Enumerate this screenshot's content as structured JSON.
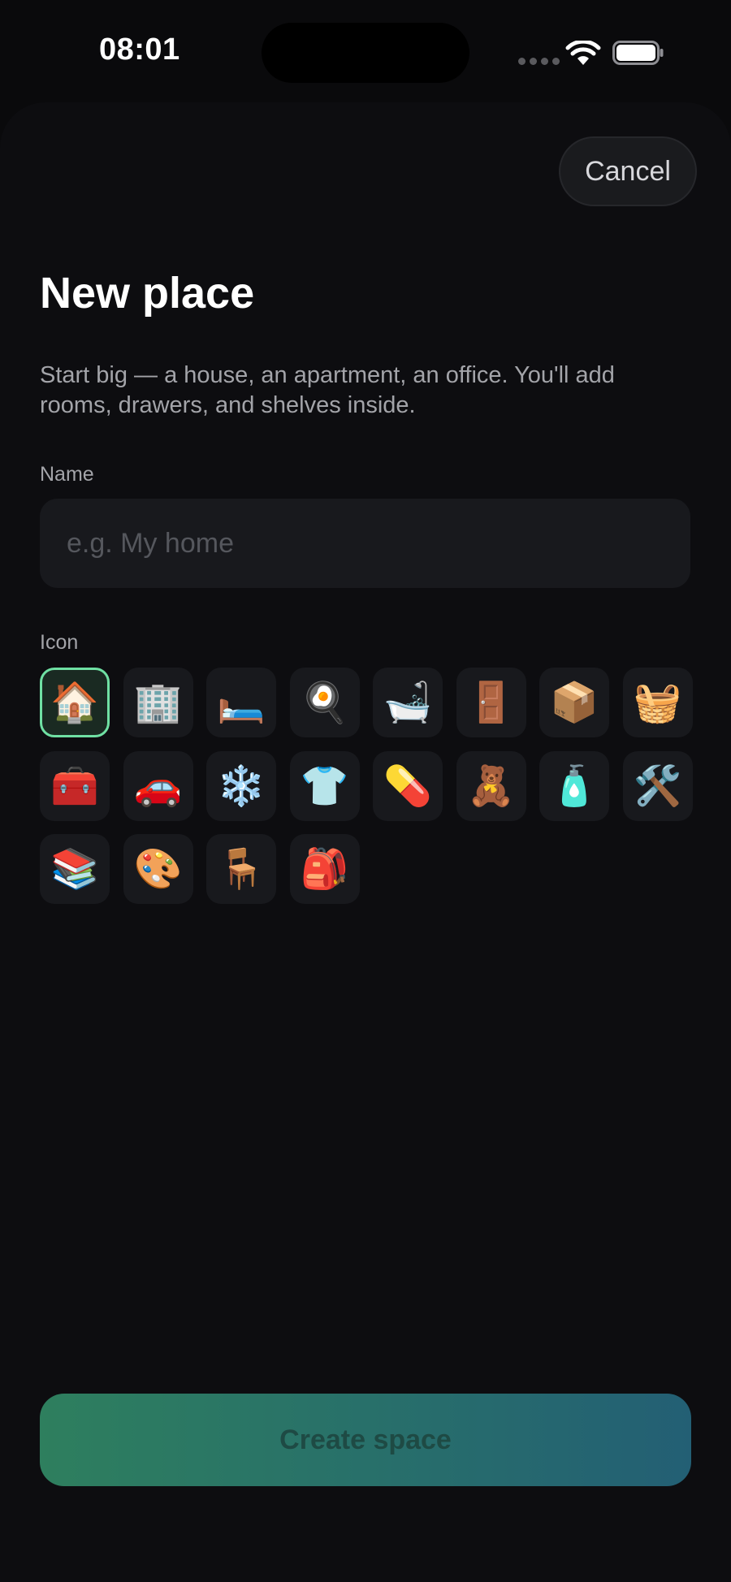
{
  "status_bar": {
    "time": "08:01"
  },
  "header": {
    "cancel_label": "Cancel",
    "title": "New place",
    "subtitle": "Start big — a house, an apartment, an office. You'll add rooms, drawers, and shelves inside."
  },
  "form": {
    "name_label": "Name",
    "name_value": "",
    "name_placeholder": "e.g. My home",
    "icon_label": "Icon",
    "selected_icon": "house",
    "icons": [
      {
        "name": "house",
        "glyph": "🏠"
      },
      {
        "name": "office-building",
        "glyph": "🏢"
      },
      {
        "name": "bed",
        "glyph": "🛏️"
      },
      {
        "name": "frying-pan",
        "glyph": "🍳"
      },
      {
        "name": "bathtub",
        "glyph": "🛁"
      },
      {
        "name": "door",
        "glyph": "🚪"
      },
      {
        "name": "package",
        "glyph": "📦"
      },
      {
        "name": "laundry-basket",
        "glyph": "🧺"
      },
      {
        "name": "toolbox",
        "glyph": "🧰"
      },
      {
        "name": "car",
        "glyph": "🚗"
      },
      {
        "name": "snowflake",
        "glyph": "❄️"
      },
      {
        "name": "shirt",
        "glyph": "👕"
      },
      {
        "name": "pill",
        "glyph": "💊"
      },
      {
        "name": "teddy-bear",
        "glyph": "🧸"
      },
      {
        "name": "lotion-bottle",
        "glyph": "🧴"
      },
      {
        "name": "hammer-and-wrench",
        "glyph": "🛠️"
      },
      {
        "name": "books",
        "glyph": "📚"
      },
      {
        "name": "artist-palette",
        "glyph": "🎨"
      },
      {
        "name": "chair",
        "glyph": "🪑"
      },
      {
        "name": "backpack",
        "glyph": "🎒"
      }
    ]
  },
  "footer": {
    "create_label": "Create space"
  },
  "colors": {
    "accent": "#6fe0a3",
    "button_gradient_start": "#2e7f5e",
    "button_gradient_end": "#235f74"
  }
}
